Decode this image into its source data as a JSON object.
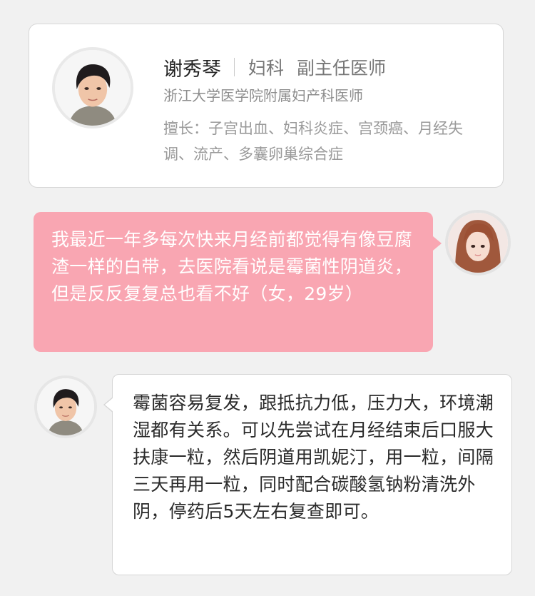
{
  "doctor": {
    "name": "谢秀琴",
    "department": "妇科",
    "title": "副主任医师",
    "hospital": "浙江大学医学院附属妇产科医师",
    "specialty": "擅长：子宫出血、妇科炎症、宫颈癌、月经失调、流产、多囊卵巢综合症",
    "avatar_icon": "doctor-portrait"
  },
  "question": {
    "text": "我最近一年多每次快来月经前都觉得有像豆腐渣一样的白带，去医院看说是霉菌性阴道炎，但是反反复复总也看不好（女，29岁）",
    "avatar_icon": "user-portrait"
  },
  "answer": {
    "text": "霉菌容易复发，跟抵抗力低，压力大，环境潮湿都有关系。可以先尝试在月经结束后口服大扶康一粒，然后阴道用凯妮汀，用一粒，间隔三天再用一粒，同时配合碳酸氢钠粉清洗外阴，停药后5天左右复查即可。",
    "avatar_icon": "doctor-portrait"
  },
  "colors": {
    "background": "#f1f1f1",
    "question_bubble": "#f9a6b2",
    "card_border": "#d6d6d6"
  }
}
